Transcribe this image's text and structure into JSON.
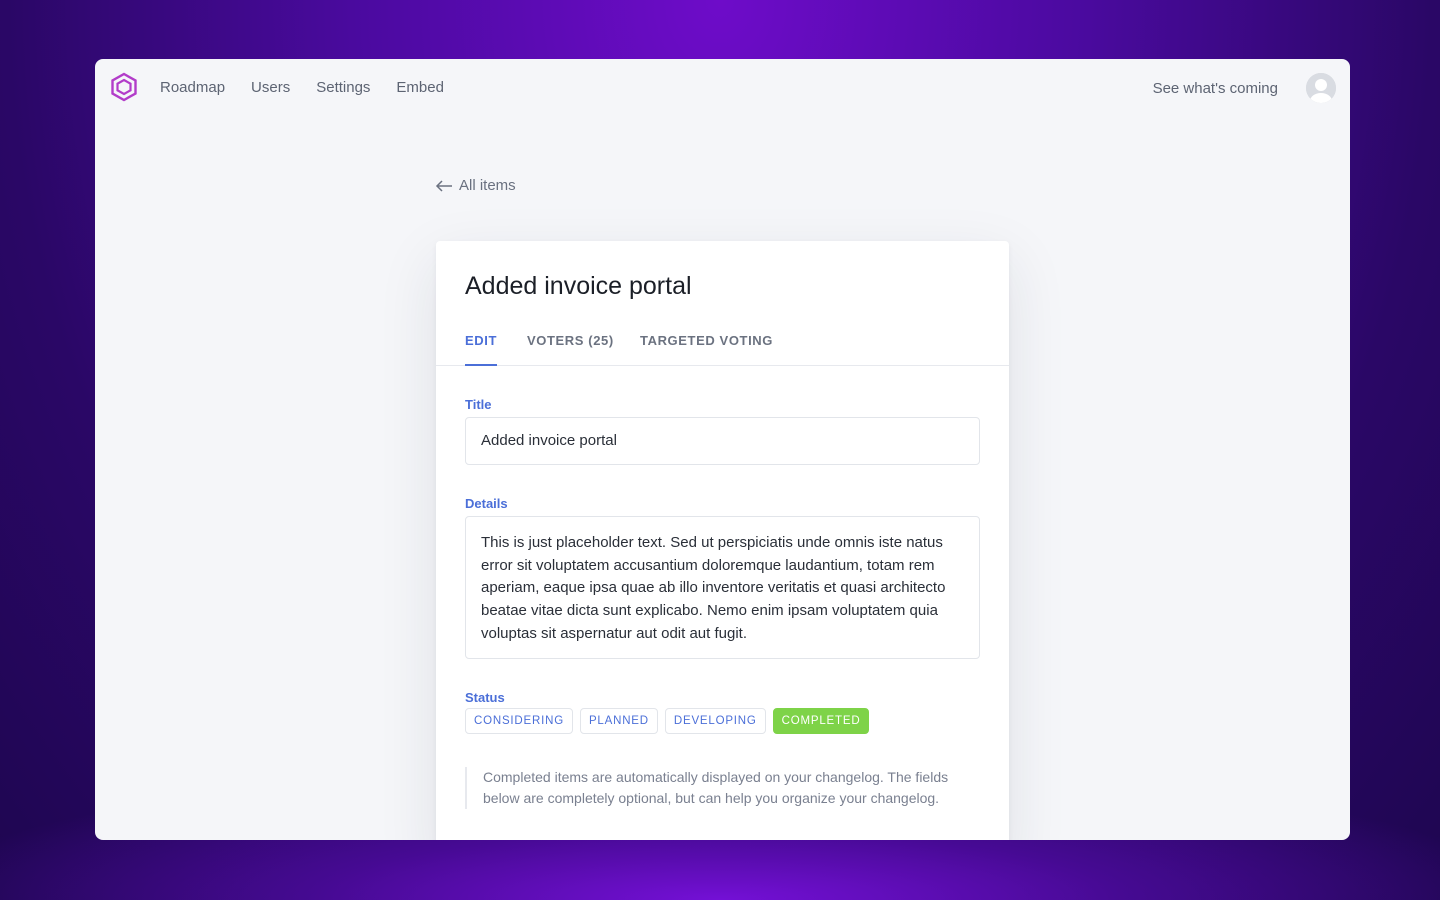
{
  "nav": {
    "items": [
      "Roadmap",
      "Users",
      "Settings",
      "Embed"
    ],
    "see_whats_coming": "See what's coming"
  },
  "back_link": "All items",
  "card": {
    "title": "Added invoice portal",
    "tabs": [
      {
        "label": "EDIT",
        "active": true
      },
      {
        "label": "VOTERS (25)",
        "active": false
      },
      {
        "label": "TARGETED VOTING",
        "active": false
      }
    ]
  },
  "form": {
    "title_label": "Title",
    "title_value": "Added invoice portal",
    "details_label": "Details",
    "details_value": "This is just placeholder text. Sed ut perspiciatis unde omnis iste natus error sit voluptatem accusantium doloremque laudantium, totam rem aperiam, eaque ipsa quae ab illo inventore veritatis et quasi architecto beatae vitae dicta sunt explicabo. Nemo enim ipsam voluptatem quia voluptas sit aspernatur aut odit aut fugit.",
    "status_label": "Status",
    "statuses": [
      {
        "label": "CONSIDERING",
        "selected": false
      },
      {
        "label": "PLANNED",
        "selected": false
      },
      {
        "label": "DEVELOPING",
        "selected": false
      },
      {
        "label": "COMPLETED",
        "selected": true
      }
    ],
    "note": "Completed items are automatically displayed on your changelog. The fields below are completely optional, but can help you organize your changelog."
  },
  "colors": {
    "accent": "#4b6fd8",
    "completed": "#7ed348",
    "logo": "#b23cc9"
  },
  "icons": {
    "logo": "hexagon-logo-icon",
    "back": "arrow-left-icon",
    "avatar": "user-avatar-icon"
  }
}
